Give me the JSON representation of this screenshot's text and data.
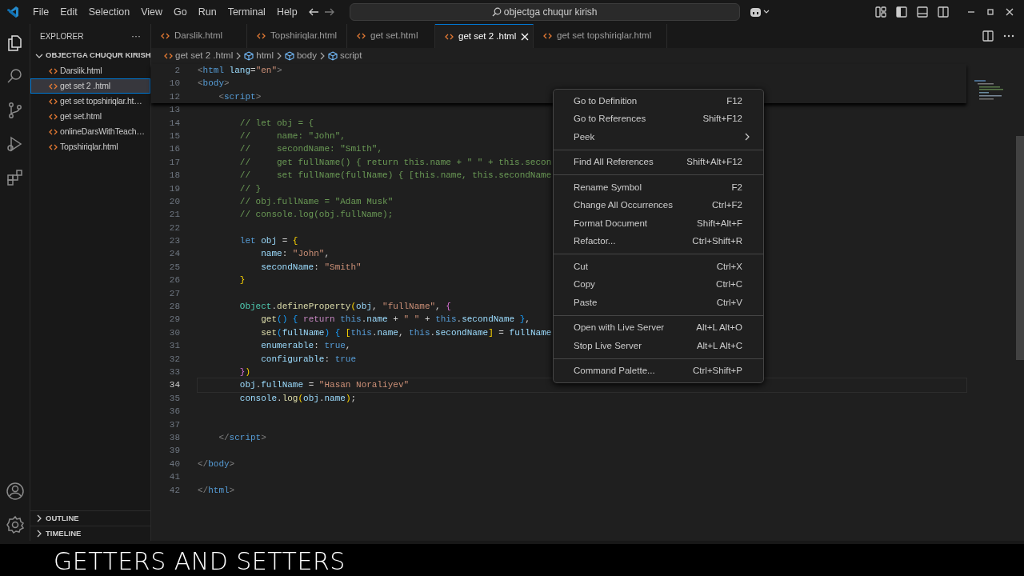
{
  "menu_bar": [
    "File",
    "Edit",
    "Selection",
    "View",
    "Go",
    "Run",
    "Terminal",
    "Help"
  ],
  "search": {
    "value": "objectga chuqur kirish"
  },
  "sidebar": {
    "title": "EXPLORER",
    "more": "···",
    "folder": {
      "label": "OBJECTGA CHUQUR KIRISH",
      "expanded": true,
      "children": [
        {
          "label": "Darslik.html",
          "selected": false
        },
        {
          "label": "get set 2 .html",
          "selected": true
        },
        {
          "label": "get set topshiriqlar.ht…",
          "selected": false
        },
        {
          "label": "get set.html",
          "selected": false
        },
        {
          "label": "onlineDarsWithTeach…",
          "selected": false
        },
        {
          "label": "Topshiriqlar.html",
          "selected": false
        }
      ]
    },
    "sections": [
      {
        "label": "OUTLINE",
        "expanded": false
      },
      {
        "label": "TIMELINE",
        "expanded": false
      }
    ]
  },
  "tabs": [
    {
      "label": "Darslik.html",
      "selected": false
    },
    {
      "label": "Topshiriqlar.html",
      "selected": false
    },
    {
      "label": "get set.html",
      "selected": false
    },
    {
      "label": "get set 2 .html",
      "selected": true
    },
    {
      "label": "get set topshiriqlar.html",
      "selected": false
    }
  ],
  "breadcrumb": [
    {
      "label": "get set 2 .html",
      "kind": "file"
    },
    {
      "label": "html",
      "kind": "element"
    },
    {
      "label": "body",
      "kind": "element"
    },
    {
      "label": "script",
      "kind": "element"
    }
  ],
  "code": [
    {
      "number": "2",
      "sticky": true,
      "current": false,
      "tokens": [
        {
          "kind": "punct",
          "text": "<"
        },
        {
          "kind": "tag",
          "text": "html"
        },
        {
          "kind": "attr",
          "text": " lang"
        },
        {
          "kind": "plain",
          "text": "="
        },
        {
          "kind": "string",
          "text": "\"en\""
        },
        {
          "kind": "punct",
          "text": ">"
        }
      ]
    },
    {
      "number": "10",
      "sticky": true,
      "current": false,
      "tokens": [
        {
          "kind": "punct",
          "text": "<"
        },
        {
          "kind": "tag",
          "text": "body"
        },
        {
          "kind": "punct",
          "text": ">"
        }
      ]
    },
    {
      "number": "12",
      "sticky": true,
      "current": false,
      "tokens": [
        {
          "kind": "punct",
          "text": "    <"
        },
        {
          "kind": "tag",
          "text": "script"
        },
        {
          "kind": "punct",
          "text": ">"
        }
      ]
    },
    {
      "number": "13",
      "sticky": false,
      "current": false
    },
    {
      "number": "14",
      "sticky": false,
      "current": false,
      "tokens": [
        {
          "kind": "comment",
          "text": "        // let obj = {"
        }
      ]
    },
    {
      "number": "15",
      "sticky": false,
      "current": false,
      "tokens": [
        {
          "kind": "comment",
          "text": "        //     name: \"John\","
        }
      ]
    },
    {
      "number": "16",
      "sticky": false,
      "current": false,
      "tokens": [
        {
          "kind": "comment",
          "text": "        //     secondName: \"Smith\","
        }
      ]
    },
    {
      "number": "17",
      "sticky": false,
      "current": false,
      "tokens": [
        {
          "kind": "comment",
          "text": "        //     get fullName() { return this.name + \" \" + this.secon"
        }
      ]
    },
    {
      "number": "18",
      "sticky": false,
      "current": false,
      "tokens": [
        {
          "kind": "comment",
          "text": "        //     set fullName(fullName) { [this.name, this.secondName"
        }
      ]
    },
    {
      "number": "19",
      "sticky": false,
      "current": false,
      "tokens": [
        {
          "kind": "comment",
          "text": "        // }"
        }
      ]
    },
    {
      "number": "20",
      "sticky": false,
      "current": false,
      "tokens": [
        {
          "kind": "comment",
          "text": "        // obj.fullName = \"Adam Musk\""
        }
      ]
    },
    {
      "number": "21",
      "sticky": false,
      "current": false,
      "tokens": [
        {
          "kind": "comment",
          "text": "        // console.log(obj.fullName);"
        }
      ]
    },
    {
      "number": "22",
      "sticky": false,
      "current": false
    },
    {
      "number": "23",
      "sticky": false,
      "current": false,
      "tokens": [
        {
          "kind": "keyword",
          "text": "        let"
        },
        {
          "kind": "var",
          "text": " obj"
        },
        {
          "kind": "plain",
          "text": " = "
        },
        {
          "kind": "brace1",
          "text": "{"
        }
      ]
    },
    {
      "number": "24",
      "sticky": false,
      "current": false,
      "tokens": [
        {
          "kind": "var",
          "text": "            name"
        },
        {
          "kind": "plain",
          "text": ": "
        },
        {
          "kind": "string",
          "text": "\"John\""
        },
        {
          "kind": "plain",
          "text": ","
        }
      ]
    },
    {
      "number": "25",
      "sticky": false,
      "current": false,
      "tokens": [
        {
          "kind": "var",
          "text": "            secondName"
        },
        {
          "kind": "plain",
          "text": ": "
        },
        {
          "kind": "string",
          "text": "\"Smith\""
        }
      ]
    },
    {
      "number": "26",
      "sticky": false,
      "current": false,
      "tokens": [
        {
          "kind": "brace1",
          "text": "        }"
        }
      ]
    },
    {
      "number": "27",
      "sticky": false,
      "current": false
    },
    {
      "number": "28",
      "sticky": false,
      "current": false,
      "tokens": [
        {
          "kind": "class",
          "text": "        Object"
        },
        {
          "kind": "plain",
          "text": "."
        },
        {
          "kind": "func",
          "text": "defineProperty"
        },
        {
          "kind": "brace1",
          "text": "("
        },
        {
          "kind": "var",
          "text": "obj"
        },
        {
          "kind": "plain",
          "text": ", "
        },
        {
          "kind": "string",
          "text": "\"fullName\""
        },
        {
          "kind": "plain",
          "text": ", "
        },
        {
          "kind": "brace2",
          "text": "{"
        }
      ]
    },
    {
      "number": "29",
      "sticky": false,
      "current": false,
      "tokens": [
        {
          "kind": "func",
          "text": "            get"
        },
        {
          "kind": "brace3",
          "text": "()"
        },
        {
          "kind": "brace3",
          "text": " {"
        },
        {
          "kind": "control",
          "text": " return"
        },
        {
          "kind": "keyword",
          "text": " this"
        },
        {
          "kind": "plain",
          "text": "."
        },
        {
          "kind": "var",
          "text": "name"
        },
        {
          "kind": "plain",
          "text": " + "
        },
        {
          "kind": "string",
          "text": "\" \""
        },
        {
          "kind": "plain",
          "text": " + "
        },
        {
          "kind": "keyword",
          "text": "this"
        },
        {
          "kind": "plain",
          "text": "."
        },
        {
          "kind": "var",
          "text": "secondName"
        },
        {
          "kind": "brace3",
          "text": " }"
        },
        {
          "kind": "plain",
          "text": ","
        }
      ]
    },
    {
      "number": "30",
      "sticky": false,
      "current": false,
      "tokens": [
        {
          "kind": "func",
          "text": "            set"
        },
        {
          "kind": "brace3",
          "text": "("
        },
        {
          "kind": "var",
          "text": "fullName"
        },
        {
          "kind": "brace3",
          "text": ")"
        },
        {
          "kind": "brace3",
          "text": " {"
        },
        {
          "kind": "brace1",
          "text": " ["
        },
        {
          "kind": "keyword",
          "text": "this"
        },
        {
          "kind": "plain",
          "text": "."
        },
        {
          "kind": "var",
          "text": "name"
        },
        {
          "kind": "plain",
          "text": ", "
        },
        {
          "kind": "keyword",
          "text": "this"
        },
        {
          "kind": "plain",
          "text": "."
        },
        {
          "kind": "var",
          "text": "secondName"
        },
        {
          "kind": "brace1",
          "text": "]"
        },
        {
          "kind": "plain",
          "text": " = "
        },
        {
          "kind": "var",
          "text": "fullName"
        }
      ]
    },
    {
      "number": "31",
      "sticky": false,
      "current": false,
      "tokens": [
        {
          "kind": "var",
          "text": "            enumerable"
        },
        {
          "kind": "plain",
          "text": ": "
        },
        {
          "kind": "keyword",
          "text": "true"
        },
        {
          "kind": "plain",
          "text": ","
        }
      ]
    },
    {
      "number": "32",
      "sticky": false,
      "current": false,
      "tokens": [
        {
          "kind": "var",
          "text": "            configurable"
        },
        {
          "kind": "plain",
          "text": ": "
        },
        {
          "kind": "keyword",
          "text": "true"
        }
      ]
    },
    {
      "number": "33",
      "sticky": false,
      "current": false,
      "tokens": [
        {
          "kind": "brace2",
          "text": "        }"
        },
        {
          "kind": "brace1",
          "text": ")"
        }
      ]
    },
    {
      "number": "34",
      "sticky": false,
      "current": true,
      "tokens": [
        {
          "kind": "var",
          "text": "        obj"
        },
        {
          "kind": "plain",
          "text": "."
        },
        {
          "kind": "var",
          "text": "fullName"
        },
        {
          "kind": "plain",
          "text": " = "
        },
        {
          "kind": "string",
          "text": "\"Hasan Noraliyev\""
        }
      ]
    },
    {
      "number": "35",
      "sticky": false,
      "current": false,
      "tokens": [
        {
          "kind": "var",
          "text": "        console"
        },
        {
          "kind": "plain",
          "text": "."
        },
        {
          "kind": "func",
          "text": "log"
        },
        {
          "kind": "brace1",
          "text": "("
        },
        {
          "kind": "var",
          "text": "obj"
        },
        {
          "kind": "plain",
          "text": "."
        },
        {
          "kind": "var",
          "text": "name"
        },
        {
          "kind": "brace1",
          "text": ")"
        },
        {
          "kind": "plain",
          "text": ";"
        }
      ]
    },
    {
      "number": "36",
      "sticky": false,
      "current": false
    },
    {
      "number": "37",
      "sticky": false,
      "current": false
    },
    {
      "number": "38",
      "sticky": false,
      "current": false,
      "tokens": [
        {
          "kind": "punct",
          "text": "    </"
        },
        {
          "kind": "tag",
          "text": "script"
        },
        {
          "kind": "punct",
          "text": ">"
        }
      ]
    },
    {
      "number": "39",
      "sticky": false,
      "current": false
    },
    {
      "number": "40",
      "sticky": false,
      "current": false,
      "tokens": [
        {
          "kind": "punct",
          "text": "</"
        },
        {
          "kind": "tag",
          "text": "body"
        },
        {
          "kind": "punct",
          "text": ">"
        }
      ]
    },
    {
      "number": "41",
      "sticky": false,
      "current": false
    },
    {
      "number": "42",
      "sticky": false,
      "current": false,
      "tokens": [
        {
          "kind": "punct",
          "text": "</"
        },
        {
          "kind": "tag",
          "text": "html"
        },
        {
          "kind": "punct",
          "text": ">"
        }
      ]
    }
  ],
  "context_menu": [
    [
      {
        "label": "Go to Definition",
        "shortcut": "F12",
        "submenu": false
      },
      {
        "label": "Go to References",
        "shortcut": "Shift+F12",
        "submenu": false
      },
      {
        "label": "Peek",
        "submenu": true
      }
    ],
    [
      {
        "label": "Find All References",
        "shortcut": "Shift+Alt+F12",
        "submenu": false
      }
    ],
    [
      {
        "label": "Rename Symbol",
        "shortcut": "F2",
        "submenu": false
      },
      {
        "label": "Change All Occurrences",
        "shortcut": "Ctrl+F2",
        "submenu": false
      },
      {
        "label": "Format Document",
        "shortcut": "Shift+Alt+F",
        "submenu": false
      },
      {
        "label": "Refactor...",
        "shortcut": "Ctrl+Shift+R",
        "submenu": false
      }
    ],
    [
      {
        "label": "Cut",
        "shortcut": "Ctrl+X",
        "submenu": false
      },
      {
        "label": "Copy",
        "shortcut": "Ctrl+C",
        "submenu": false
      },
      {
        "label": "Paste",
        "shortcut": "Ctrl+V",
        "submenu": false
      }
    ],
    [
      {
        "label": "Open with Live Server",
        "shortcut": "Alt+L Alt+O",
        "submenu": false
      },
      {
        "label": "Stop Live Server",
        "shortcut": "Alt+L Alt+C",
        "submenu": false
      }
    ],
    [
      {
        "label": "Command Palette...",
        "shortcut": "Ctrl+Shift+P",
        "submenu": false
      }
    ]
  ],
  "caption": "GETTERS AND SETTERS"
}
